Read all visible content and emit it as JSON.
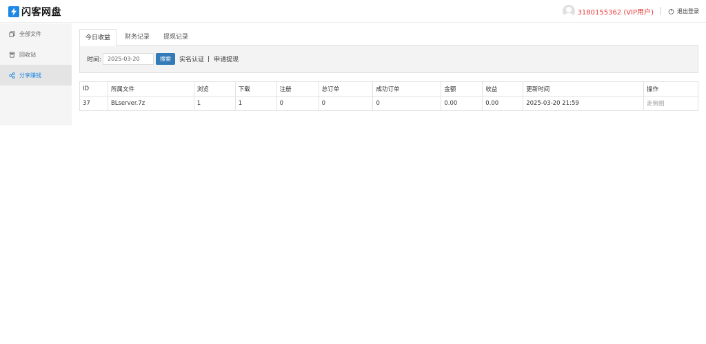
{
  "header": {
    "logo_text": "闪客网盘",
    "username": "3180155362 (VIP用户)",
    "logout_label": "退出登录"
  },
  "sidebar": {
    "items": [
      {
        "label": "全部文件",
        "icon": "copy-icon",
        "active": false
      },
      {
        "label": "回收站",
        "icon": "trash-icon",
        "active": false
      },
      {
        "label": "分享赚钱",
        "icon": "share-icon",
        "active": true
      }
    ]
  },
  "tabs": [
    {
      "label": "今日收益",
      "active": true
    },
    {
      "label": "财务记录",
      "active": false
    },
    {
      "label": "提现记录",
      "active": false
    }
  ],
  "filter": {
    "label": "时间:",
    "date_value": "2025-03-20",
    "search_label": "搜索",
    "verify_label": "实名认证",
    "separator": "|",
    "withdraw_label": "申请提现"
  },
  "table": {
    "columns": [
      "ID",
      "所属文件",
      "浏览",
      "下载",
      "注册",
      "总订单",
      "成功订单",
      "金额",
      "收益",
      "更新时间",
      "操作"
    ],
    "rows": [
      [
        "37",
        "BLserver.7z",
        "1",
        "1",
        "0",
        "0",
        "0",
        "0.00",
        "0.00",
        "2025-03-20 21:59",
        "走势图"
      ]
    ]
  },
  "colors": {
    "accent": "#1e88e5",
    "button": "#337ab7",
    "vip": "#e53935"
  }
}
